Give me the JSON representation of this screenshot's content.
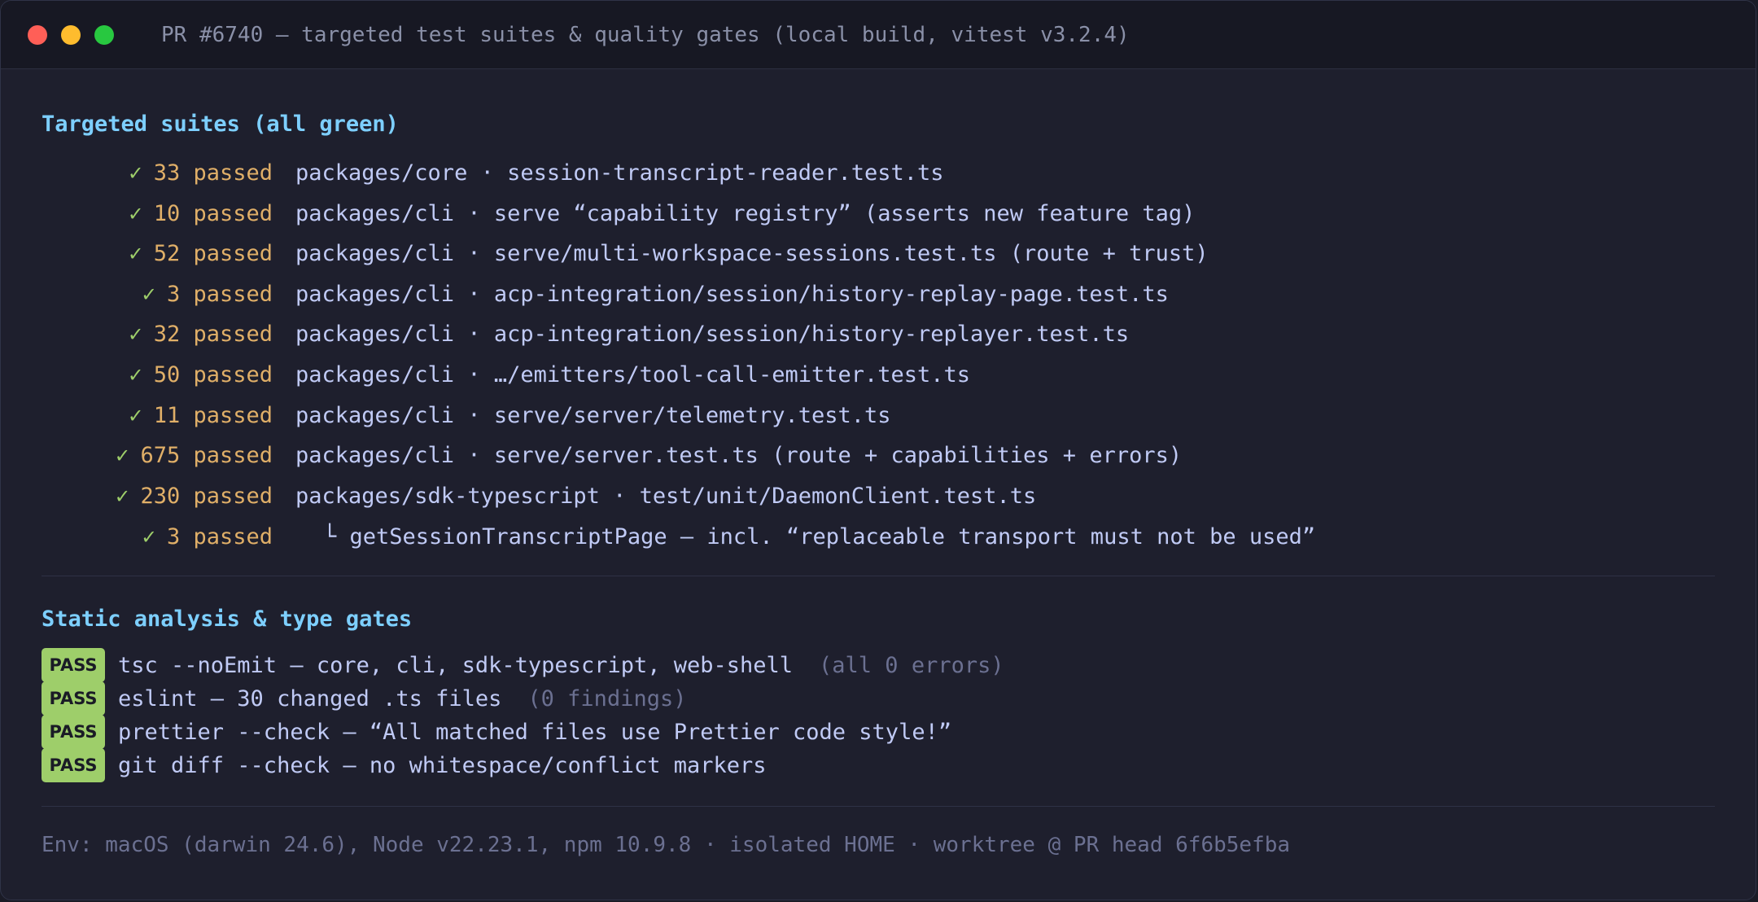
{
  "window": {
    "title": "PR #6740 — targeted test suites & quality gates (local build, vitest v3.2.4)"
  },
  "targeted": {
    "heading": "Targeted suites (all green)",
    "check_glyph": "✓",
    "rows": [
      {
        "count": "33 passed",
        "path": "packages/core · session-transcript-reader.test.ts"
      },
      {
        "count": "10 passed",
        "path": "packages/cli · serve “capability registry” (asserts new feature tag)"
      },
      {
        "count": "52 passed",
        "path": "packages/cli · serve/multi-workspace-sessions.test.ts (route + trust)"
      },
      {
        "count": "3 passed",
        "path": "packages/cli · acp-integration/session/history-replay-page.test.ts"
      },
      {
        "count": "32 passed",
        "path": "packages/cli · acp-integration/session/history-replayer.test.ts"
      },
      {
        "count": "50 passed",
        "path": "packages/cli · …/emitters/tool-call-emitter.test.ts"
      },
      {
        "count": "11 passed",
        "path": "packages/cli · serve/server/telemetry.test.ts"
      },
      {
        "count": "675 passed",
        "path": "packages/cli · serve/server.test.ts (route + capabilities + errors)"
      },
      {
        "count": "230 passed",
        "path": "packages/sdk-typescript · test/unit/DaemonClient.test.ts"
      },
      {
        "count": "3 passed",
        "path": "└ getSessionTranscriptPage — incl. “replaceable transport must not be used”"
      }
    ]
  },
  "gates": {
    "heading": "Static analysis & type gates",
    "badge_label": "PASS",
    "rows": [
      {
        "text": "tsc --noEmit — core, cli, sdk-typescript, web-shell",
        "note": "(all 0 errors)"
      },
      {
        "text": "eslint — 30 changed .ts files",
        "note": "(0 findings)"
      },
      {
        "text": "prettier --check — “All matched files use Prettier code style!”",
        "note": ""
      },
      {
        "text": "git diff --check — no whitespace/conflict markers",
        "note": ""
      }
    ]
  },
  "footer": {
    "env": "Env: macOS (darwin 24.6), Node v22.23.1, npm 10.9.8 · isolated HOME · worktree @ PR head 6f6b5efba"
  },
  "colors": {
    "heading": "#7dcfff",
    "check": "#9ece6a",
    "count": "#e0af68",
    "badge": "#9ece6a",
    "muted": "#6b7091"
  }
}
